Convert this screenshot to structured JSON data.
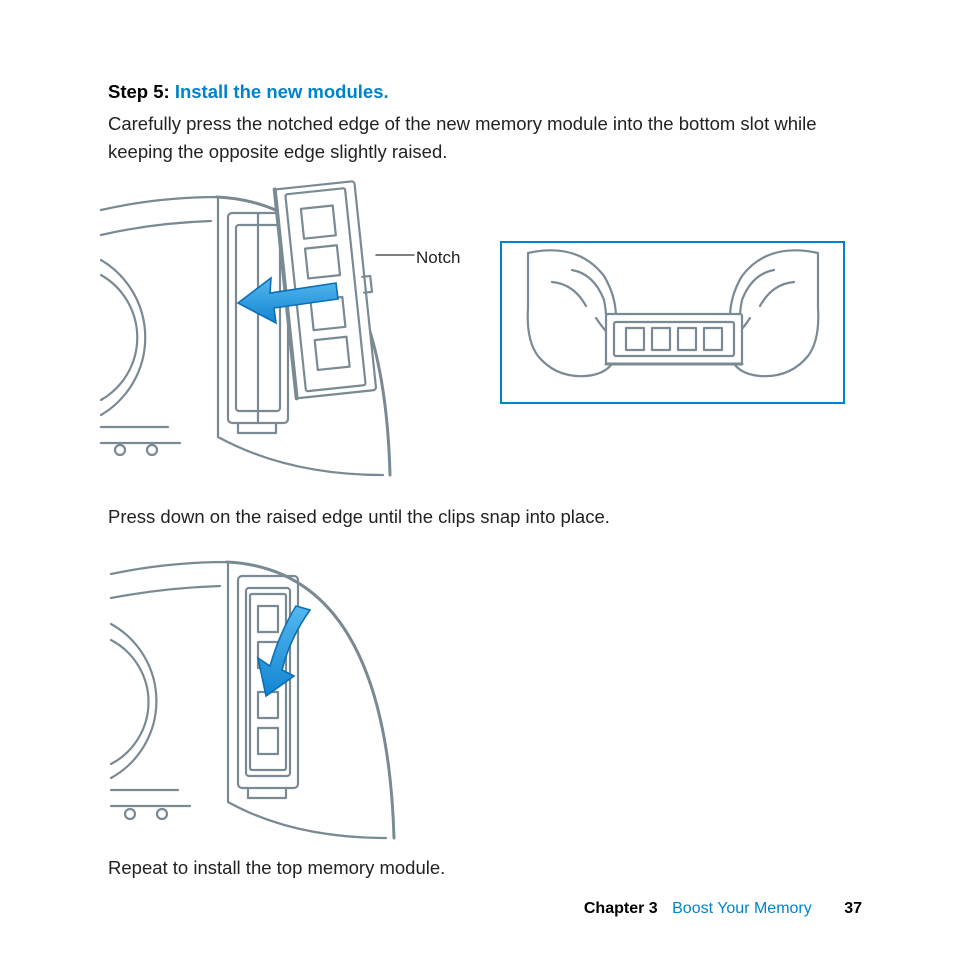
{
  "step": {
    "label": "Step 5:",
    "title": "Install the new modules."
  },
  "para1": "Carefully press the notched edge of the new memory module into the bottom slot while keeping the opposite edge slightly raised.",
  "fig1": {
    "callout": "Notch"
  },
  "para2": "Press down on the raised edge until the clips snap into place.",
  "para3": "Repeat to install the top memory module.",
  "footer": {
    "chapter_label": "Chapter 3",
    "chapter_title": "Boost Your Memory",
    "page_number": "37"
  },
  "colors": {
    "accent": "#0083cc"
  }
}
